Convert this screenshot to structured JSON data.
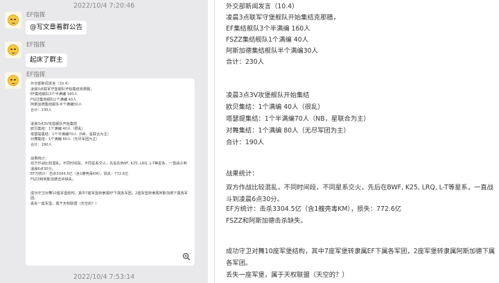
{
  "chat": {
    "messages": [
      {
        "timestamp": "2022/10/4 7:20:46",
        "sender": "EF指挥",
        "text": "@写文章看群公告"
      },
      {
        "sender": "EF指挥",
        "text": "起床了群主"
      },
      {
        "sender": "EF指挥",
        "image": true
      }
    ],
    "footer_timestamp": "2022/10/4 7:53:14",
    "zoom_icon": "magnifier-plus-icon"
  },
  "document": {
    "header": "外交部新闻发言（10.4）",
    "section1": [
      "凌晨3点联军守堡舰队开始集结克那腊，",
      "EF集结舰队3个半满编 160人",
      "FSZZ集结舰队1个满编 40人",
      "阿斯加德集结舰队半个满编30人",
      "合计：230人"
    ],
    "section2": [
      "凌晨3点3V攻堡舰队开始集结",
      "欧贝集结：1个满编 40人（很乱）",
      "塔瑟提集结：1个半满编70人（NB，星联合为主）",
      "对舞集结：1个满编 80人（无尽军团为主）",
      "合计：190人"
    ],
    "section3": [
      "战果统计：",
      "双方作战比较混乱，不同时间段，不同星系交火，先后在BWF, K25, LRQ, L-T等星系，一直战斗到凌晨6点30分。",
      "EF方统计：击杀3304.5亿（含1艘壳毒KM），损失：772.6亿",
      "FSZZ和阿斯加德击杀缺失。"
    ],
    "section4": [
      "成功守卫对舞10座军堡结构，其中7座军堡转隶属EF下属各军团，2座军堡转隶属阿斯加德下属各军团。",
      "丢失一座军堡，属于天权联盟（天空的？）"
    ]
  }
}
